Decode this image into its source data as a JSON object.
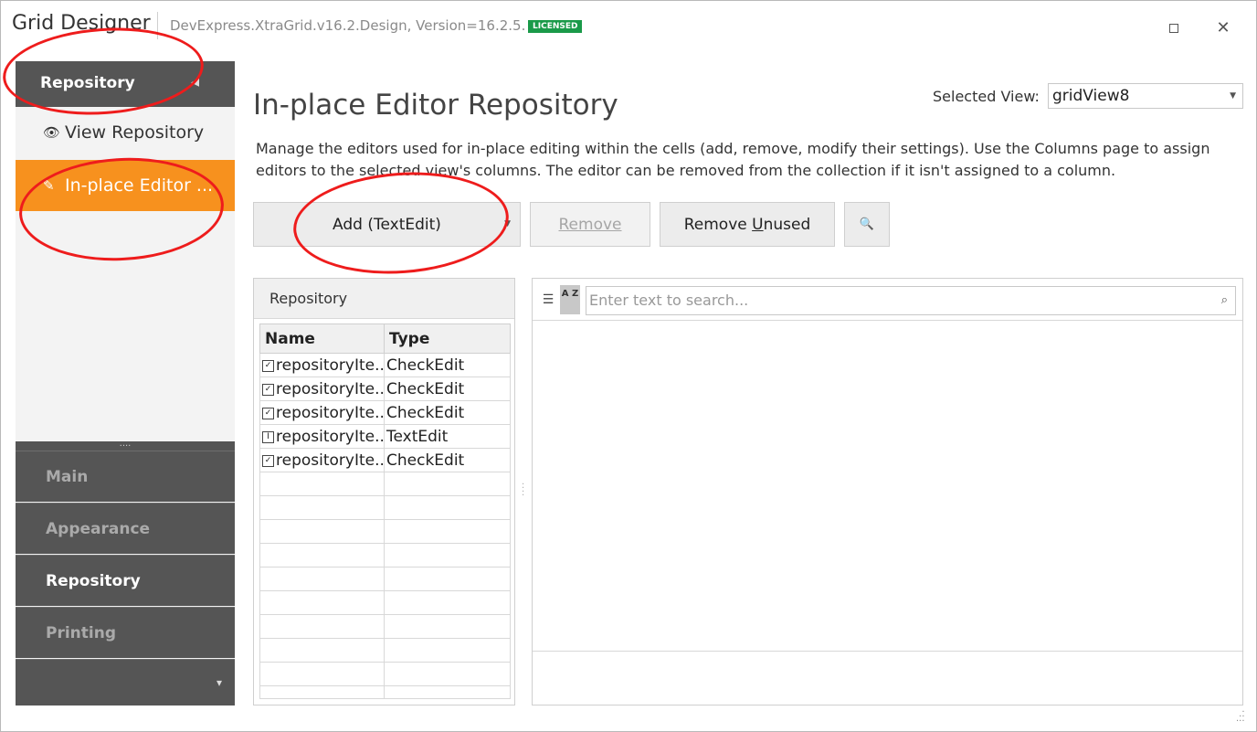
{
  "window": {
    "title": "Grid Designer",
    "subtitle": "DevExpress.XtraGrid.v16.2.Design, Version=16.2.5.",
    "badge": "LICENSED",
    "close_glyph": "✕"
  },
  "sidebar": {
    "header": "Repository",
    "header_arrow": "◂",
    "items": [
      {
        "label": "View Repository",
        "icon": "eye-icon",
        "glyph": "👁"
      },
      {
        "label": "In-place Editor ...",
        "icon": "edit-icon",
        "glyph": "✎"
      }
    ],
    "splitter": "....",
    "groups": [
      {
        "label": "Main"
      },
      {
        "label": "Appearance"
      },
      {
        "label": "Repository",
        "selected": true
      },
      {
        "label": "Printing"
      }
    ],
    "more_glyph": "▾"
  },
  "main": {
    "title": "In-place Editor Repository",
    "selected_view_label": "Selected View:",
    "selected_view_value": "gridView8",
    "description": "Manage the editors used for in-place editing within the cells (add, remove, modify their settings). Use the Columns page to assign editors to the selected view's columns. The editor can be removed from the collection if it isn't assigned to a column.",
    "buttons": {
      "add": "Add (TextEdit)",
      "remove": "Remove",
      "remove_unused_prefix": "Remove ",
      "remove_unused_mnemonic": "U",
      "remove_unused_suffix": "nused",
      "search_icon": "🔍"
    }
  },
  "repository": {
    "caption": "Repository",
    "columns": [
      "Name",
      "Type"
    ],
    "rows": [
      {
        "name": "repositoryIte...",
        "type": "CheckEdit",
        "icon": "checkbox-icon",
        "glyph": "✓"
      },
      {
        "name": "repositoryIte...",
        "type": "CheckEdit",
        "icon": "checkbox-icon",
        "glyph": "✓"
      },
      {
        "name": "repositoryIte...",
        "type": "CheckEdit",
        "icon": "checkbox-icon",
        "glyph": "✓"
      },
      {
        "name": "repositoryIte...",
        "type": "TextEdit",
        "icon": "textedit-icon",
        "glyph": "I"
      },
      {
        "name": "repositoryIte...",
        "type": "CheckEdit",
        "icon": "checkbox-icon",
        "glyph": "✓"
      }
    ],
    "empty_rows": 10
  },
  "properties": {
    "categorized_icon": "☰",
    "alphabetical_icon": "A Z",
    "search_placeholder": "Enter text to search...",
    "search_icon": "⌕"
  },
  "colors": {
    "accent": "#f7911e",
    "nav_dark": "#555555",
    "badge": "#1a9a49",
    "annotation": "#ee1c1c"
  }
}
